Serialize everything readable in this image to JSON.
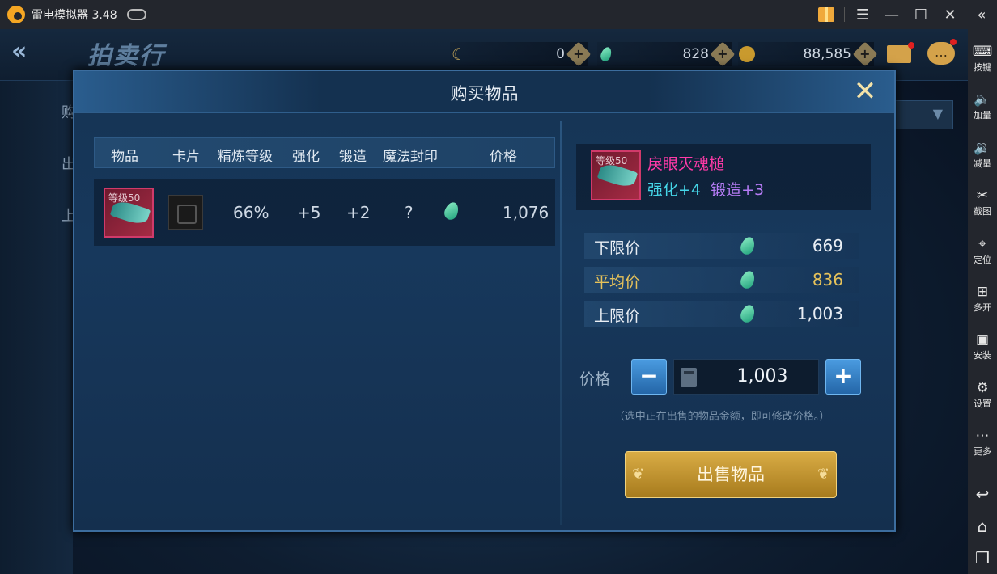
{
  "emulator": {
    "title": "雷电模拟器 3.48",
    "sidebar": [
      {
        "label": "按键",
        "icon": "keyboard-icon"
      },
      {
        "label": "加量",
        "icon": "volume-up-icon"
      },
      {
        "label": "减量",
        "icon": "volume-down-icon"
      },
      {
        "label": "截图",
        "icon": "scissors-icon"
      },
      {
        "label": "定位",
        "icon": "location-pin-icon"
      },
      {
        "label": "多开",
        "icon": "multi-instance-icon"
      },
      {
        "label": "安装",
        "icon": "apk-install-icon"
      },
      {
        "label": "设置",
        "icon": "gear-icon"
      },
      {
        "label": "更多",
        "icon": "more-dots-icon"
      }
    ]
  },
  "game": {
    "page_title": "拍卖行",
    "currencies": [
      {
        "value": "0",
        "icon": "crescent-currency-icon"
      },
      {
        "value": "828",
        "icon": "green-gem-icon"
      },
      {
        "value": "88,585",
        "icon": "gold-coin-icon"
      }
    ],
    "left_tabs": [
      "购",
      "出",
      "上"
    ]
  },
  "modal": {
    "title": "购买物品",
    "columns": [
      "物品",
      "卡片",
      "精炼等级",
      "强化",
      "锻造",
      "魔法封印",
      "价格"
    ],
    "row": {
      "item_level_label": "等级50",
      "refine": "66%",
      "enhance": "+5",
      "forge": "+2",
      "seal": "?",
      "price": "1,076"
    },
    "detail": {
      "name": "戾眼灭魂槌",
      "enhance": "强化+4",
      "forge": "锻造+3"
    },
    "prices": [
      {
        "label": "下限价",
        "value": "669"
      },
      {
        "label": "平均价",
        "value": "836"
      },
      {
        "label": "上限价",
        "value": "1,003"
      }
    ],
    "price_label": "价格",
    "price_value": "1,003",
    "hint": "（选中正在出售的物品金额，即可修改价格。）",
    "sell_button": "出售物品"
  },
  "colors": {
    "item_name": "#ff3aa8",
    "refine_stat": "#45d6e8",
    "forge_stat": "#b57cf5",
    "average_price": "#e6c25a",
    "sell_button": "#c89a33"
  }
}
